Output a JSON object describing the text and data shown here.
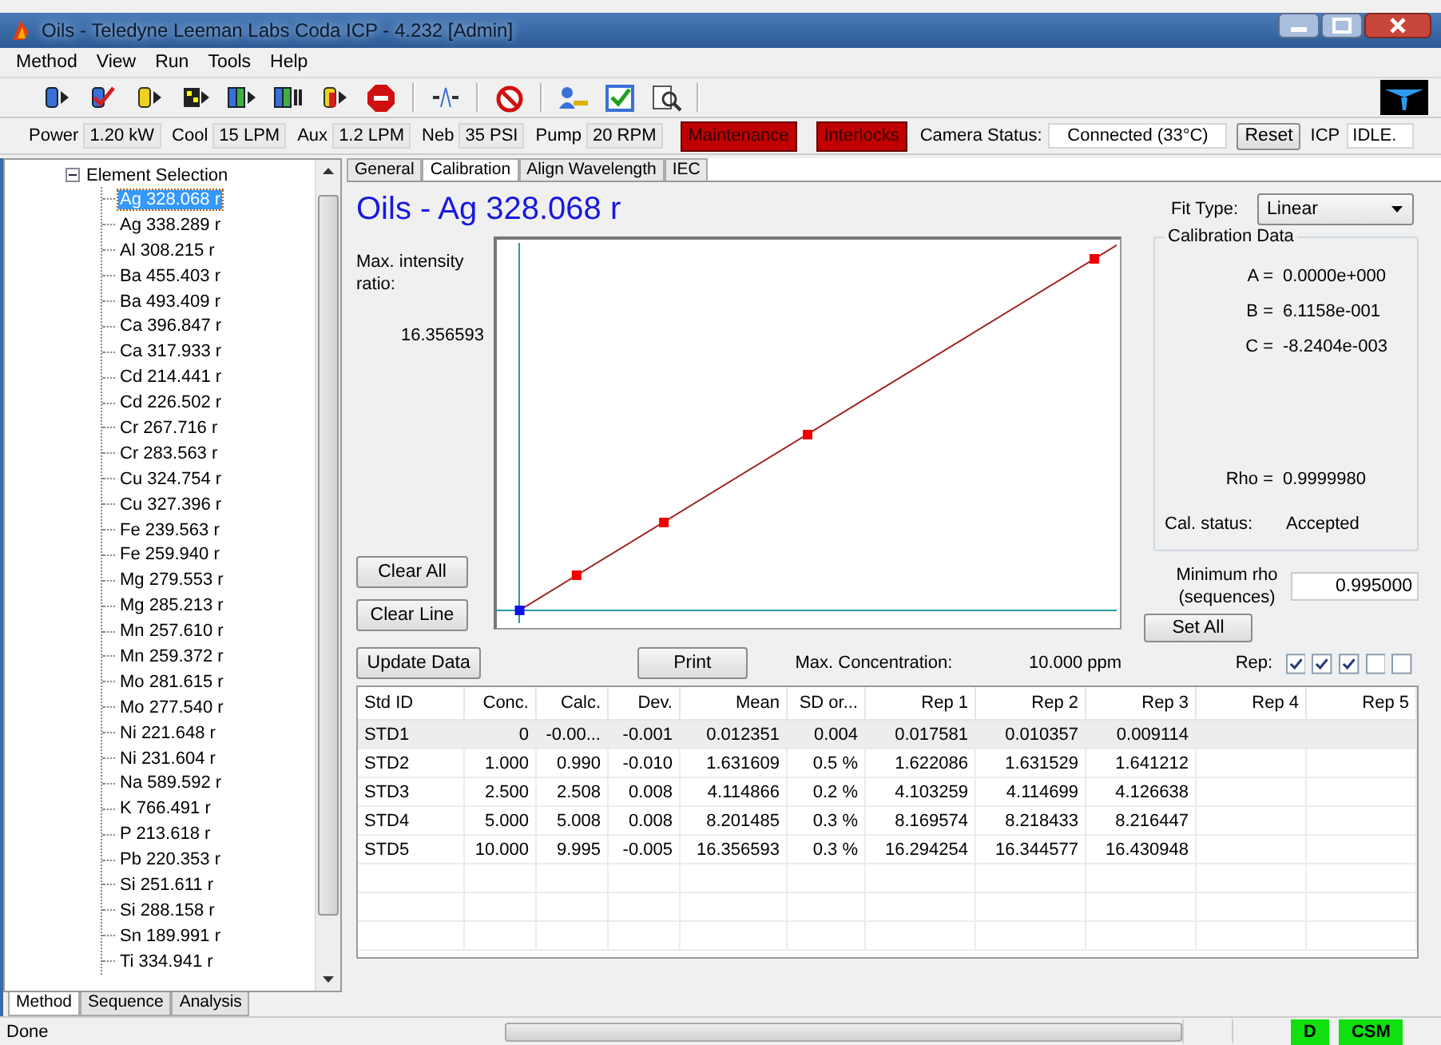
{
  "window": {
    "title": "Oils - Teledyne Leeman Labs Coda ICP - 4.232  [Admin]"
  },
  "menu": [
    "Method",
    "View",
    "Run",
    "Tools",
    "Help"
  ],
  "instrument": [
    {
      "label": "Power",
      "value": "1.20 kW"
    },
    {
      "label": "Cool",
      "value": "15 LPM"
    },
    {
      "label": "Aux",
      "value": "1.2 LPM"
    },
    {
      "label": "Neb",
      "value": "35 PSI"
    },
    {
      "label": "Pump",
      "value": "20 RPM"
    }
  ],
  "alarms": [
    {
      "label": "Maintenance",
      "color": "#c00000"
    },
    {
      "label": "Interlocks",
      "color": "#c00000"
    }
  ],
  "camera_status": {
    "label": "Camera Status:",
    "value": "Connected (33°C)"
  },
  "reset_button": "Reset",
  "icp": {
    "label": "ICP",
    "value": "IDLE."
  },
  "tree": {
    "label": "Element Selection",
    "expanded": true,
    "children": [
      {
        "label": "Ag 328.068 r",
        "selected": true
      },
      {
        "label": "Ag 338.289 r",
        "selected": false
      },
      {
        "label": "Al 308.215 r",
        "selected": false
      },
      {
        "label": "Ba 455.403 r",
        "selected": false
      },
      {
        "label": "Ba 493.409 r",
        "selected": false
      },
      {
        "label": "Ca 396.847 r",
        "selected": false
      },
      {
        "label": "Ca 317.933 r",
        "selected": false
      },
      {
        "label": "Cd 214.441 r",
        "selected": false
      },
      {
        "label": "Cd 226.502 r",
        "selected": false
      },
      {
        "label": "Cr 267.716 r",
        "selected": false
      },
      {
        "label": "Cr 283.563 r",
        "selected": false
      },
      {
        "label": "Cu 324.754 r",
        "selected": false
      },
      {
        "label": "Cu 327.396 r",
        "selected": false
      },
      {
        "label": "Fe 239.563 r",
        "selected": false
      },
      {
        "label": "Fe 259.940 r",
        "selected": false
      },
      {
        "label": "Mg 279.553 r",
        "selected": false
      },
      {
        "label": "Mg 285.213 r",
        "selected": false
      },
      {
        "label": "Mn 257.610 r",
        "selected": false
      },
      {
        "label": "Mn 259.372 r",
        "selected": false
      },
      {
        "label": "Mo 281.615 r",
        "selected": false
      },
      {
        "label": "Mo 277.540 r",
        "selected": false
      },
      {
        "label": "Ni 221.648 r",
        "selected": false
      },
      {
        "label": "Ni 231.604 r",
        "selected": false
      },
      {
        "label": "Na 589.592 r",
        "selected": false
      },
      {
        "label": "K 766.491 r",
        "selected": false
      },
      {
        "label": "P 213.618 r",
        "selected": false
      },
      {
        "label": "Pb 220.353 r",
        "selected": false
      },
      {
        "label": "Si 251.611 r",
        "selected": false
      },
      {
        "label": "Si 288.158 r",
        "selected": false
      },
      {
        "label": "Sn 189.991 r",
        "selected": false
      },
      {
        "label": "Ti 334.941 r",
        "selected": false
      }
    ]
  },
  "left_tabs": [
    {
      "label": "Method",
      "selected": true
    },
    {
      "label": "Sequence",
      "selected": false
    },
    {
      "label": "Analysis",
      "selected": false
    }
  ],
  "tabs": [
    {
      "label": "General",
      "selected": false
    },
    {
      "label": "Calibration",
      "selected": true
    },
    {
      "label": "Align Wavelength",
      "selected": false
    },
    {
      "label": "IEC",
      "selected": false
    }
  ],
  "heading": "Oils - Ag 328.068 r",
  "fit_type": {
    "label": "Fit Type:",
    "value": "Linear"
  },
  "y_label": "Max. intensity ratio:",
  "y_value": "16.356593",
  "calibration_data": {
    "title": "Calibration Data",
    "coefficients": [
      {
        "label": "A =",
        "value": "0.0000e+000"
      },
      {
        "label": "B =",
        "value": "6.1158e-001"
      },
      {
        "label": "C =",
        "value": "-8.2404e-003"
      }
    ],
    "rho": {
      "label": "Rho =",
      "value": "0.9999980"
    },
    "status": {
      "label": "Cal. status:",
      "value": "Accepted"
    }
  },
  "plot_buttons": [
    "Clear All",
    "Clear Line"
  ],
  "min_rho": {
    "label": "Minimum rho (sequences)",
    "value": "0.995000"
  },
  "set_all_button": "Set All",
  "update_button": "Update Data",
  "print_button": "Print",
  "max_concentration": {
    "label": "Max. Concentration:",
    "value": "10.000 ppm"
  },
  "rep": {
    "label": "Rep:",
    "checks": [
      true,
      true,
      true,
      false,
      false
    ]
  },
  "table": {
    "columns": [
      "Std ID",
      "Conc.",
      "Calc.",
      "Dev.",
      "Mean",
      "SD or...",
      "Rep 1",
      "Rep 2",
      "Rep 3",
      "Rep 4",
      "Rep 5"
    ],
    "rows": [
      {
        "selected": true,
        "cells": [
          "STD1",
          "0",
          "-0.00...",
          "-0.001",
          "0.012351",
          "0.004",
          "0.017581",
          "0.010357",
          "0.009114"
        ]
      },
      {
        "selected": false,
        "cells": [
          "STD2",
          "1.000",
          "0.990",
          "-0.010",
          "1.631609",
          "0.5 %",
          "1.622086",
          "1.631529",
          "1.641212"
        ]
      },
      {
        "selected": false,
        "cells": [
          "STD3",
          "2.500",
          "2.508",
          "0.008",
          "4.114866",
          "0.2 %",
          "4.103259",
          "4.114699",
          "4.126638"
        ]
      },
      {
        "selected": false,
        "cells": [
          "STD4",
          "5.000",
          "5.008",
          "0.008",
          "8.201485",
          "0.3 %",
          "8.169574",
          "8.218433",
          "8.216447"
        ]
      },
      {
        "selected": false,
        "cells": [
          "STD5",
          "10.000",
          "9.995",
          "-0.005",
          "16.356593",
          "0.3 %",
          "16.294254",
          "16.344577",
          "16.430948"
        ]
      }
    ]
  },
  "status_bar": {
    "text": "Done",
    "indicators": [
      "D",
      "CSM"
    ]
  }
}
